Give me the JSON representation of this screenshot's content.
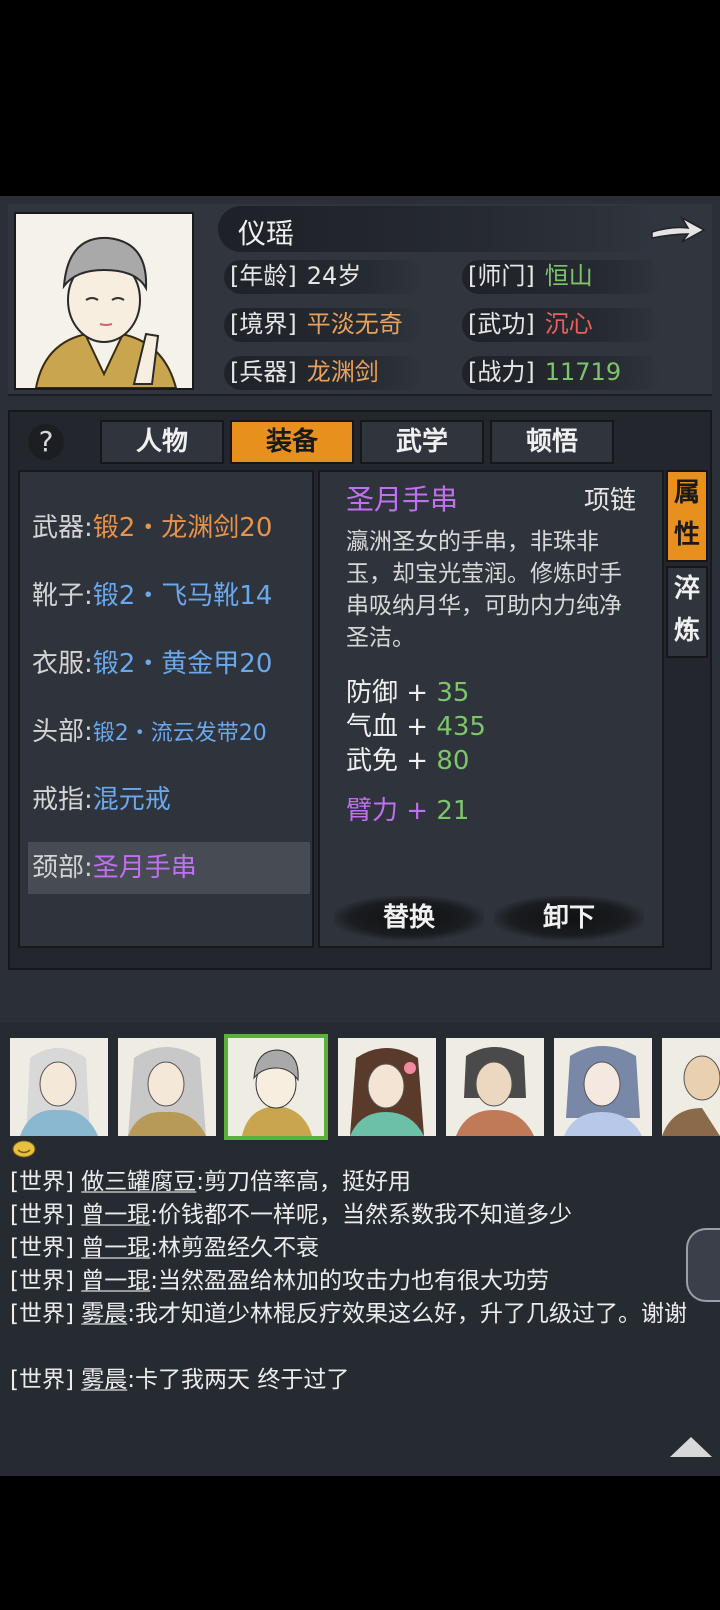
{
  "character": {
    "name": "仪瑶",
    "stats": [
      {
        "label": "[年龄]",
        "value": "24岁",
        "color": "white"
      },
      {
        "label": "[师门]",
        "value": "恒山",
        "color": "green"
      },
      {
        "label": "[境界]",
        "value": "平淡无奇",
        "color": "orange"
      },
      {
        "label": "[武功]",
        "value": "沉心",
        "color": "red"
      },
      {
        "label": "[兵器]",
        "value": "龙渊剑",
        "color": "orange"
      },
      {
        "label": "[战力]",
        "value": "11719",
        "color": "green"
      }
    ]
  },
  "tabs": [
    {
      "label": "人物",
      "active": false
    },
    {
      "label": "装备",
      "active": true
    },
    {
      "label": "武学",
      "active": false
    },
    {
      "label": "顿悟",
      "active": false
    }
  ],
  "help_label": "?",
  "equipment": [
    {
      "slot": "武器:",
      "item": "锻2・龙渊剑20",
      "color": "orange"
    },
    {
      "slot": "靴子:",
      "item": "锻2・飞马靴14",
      "color": "blue"
    },
    {
      "slot": "衣服:",
      "item": "锻2・黄金甲20",
      "color": "blue"
    },
    {
      "slot": "头部:",
      "item": "锻2・流云发带20",
      "color": "blue"
    },
    {
      "slot": "戒指:",
      "item": "混元戒",
      "color": "blue"
    },
    {
      "slot": "颈部:",
      "item": "圣月手串",
      "color": "purple",
      "selected": true
    }
  ],
  "detail": {
    "name": "圣月手串",
    "type": "项链",
    "description": "瀛洲圣女的手串，非珠非玉，却宝光莹润。修炼时手串吸纳月华，可助内力纯净圣洁。",
    "attributes": [
      {
        "label": "防御 + ",
        "value": "35"
      },
      {
        "label": "气血 + ",
        "value": "435"
      },
      {
        "label": "武免 + ",
        "value": "80"
      }
    ],
    "bonus": {
      "label": "臂力 + ",
      "value": "21"
    },
    "replace_label": "替换",
    "unequip_label": "卸下"
  },
  "side_tabs": [
    {
      "label": "属性",
      "active": true
    },
    {
      "label": "淬炼",
      "active": false
    }
  ],
  "chat": [
    {
      "channel": "[世界]",
      "user": "做三罐腐豆",
      "text": ":剪刀倍率高，挺好用"
    },
    {
      "channel": "[世界]",
      "user": "曾一琨",
      "text": ":价钱都不一样呢，当然系数我不知道多少"
    },
    {
      "channel": "[世界]",
      "user": "曾一琨",
      "text": ":林剪盈经久不衰"
    },
    {
      "channel": "[世界]",
      "user": "曾一琨",
      "text": ":当然盈盈给林加的攻击力也有很大功劳"
    },
    {
      "channel": "[世界]",
      "user": "雾晨",
      "text": ":我才知道少林棍反疗效果这么好，升了几级过了。谢谢"
    },
    {
      "channel": "[世界]",
      "user": "雾晨",
      "text": ":卡了我两天 终于过了"
    }
  ],
  "colors": {
    "accent": "#e8901e",
    "green": "#7ec46a",
    "orange": "#e8934a",
    "blue": "#6aa8ee",
    "purple": "#c070f0",
    "red": "#e86060"
  }
}
